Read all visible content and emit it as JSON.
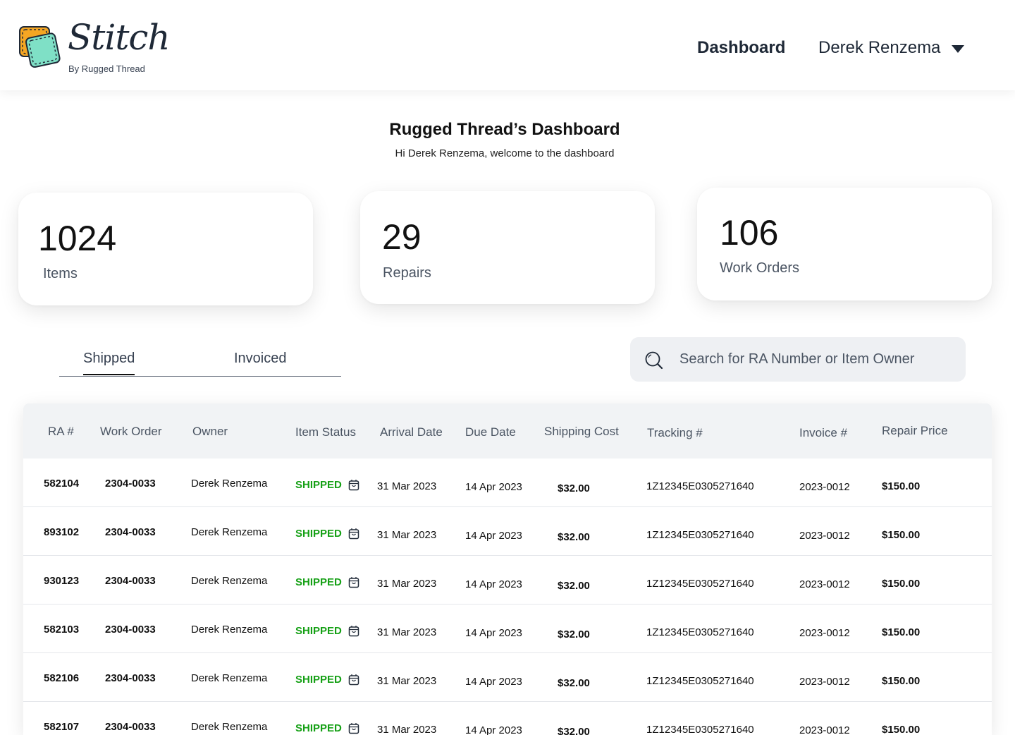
{
  "header": {
    "logo_word": "Stitch",
    "logo_sub": "By Rugged Thread",
    "nav_dashboard": "Dashboard",
    "user_name": "Derek Renzema"
  },
  "page": {
    "title": "Rugged Thread’s Dashboard",
    "subtitle": "Hi Derek Renzema, welcome to the dashboard"
  },
  "stats": [
    {
      "value": "1024",
      "label": "Items"
    },
    {
      "value": "29",
      "label": "Repairs"
    },
    {
      "value": "106",
      "label": "Work Orders"
    }
  ],
  "tabs": [
    {
      "label": "Shipped",
      "active": true
    },
    {
      "label": "Invoiced",
      "active": false
    }
  ],
  "search": {
    "placeholder": "Search for RA Number or Item Owner",
    "icon": "search-icon"
  },
  "table": {
    "columns": [
      "RA #",
      "Work Order",
      "Owner",
      "Item Status",
      "Arrival Date",
      "Due Date",
      "Shipping Cost",
      "Tracking #",
      "Invoice #",
      "Repair Price"
    ],
    "rows": [
      {
        "ra": "582104",
        "work_order": "2304-0033",
        "owner": "Derek Renzema",
        "status": "SHIPPED",
        "arrival": "31 Mar 2023",
        "due": "14 Apr 2023",
        "shipping": "$32.00",
        "tracking": "1Z12345E0305271640",
        "invoice": "2023-0012",
        "price": "$150.00"
      },
      {
        "ra": "893102",
        "work_order": "2304-0033",
        "owner": "Derek Renzema",
        "status": "SHIPPED",
        "arrival": "31 Mar 2023",
        "due": "14 Apr 2023",
        "shipping": "$32.00",
        "tracking": "1Z12345E0305271640",
        "invoice": "2023-0012",
        "price": "$150.00"
      },
      {
        "ra": "930123",
        "work_order": "2304-0033",
        "owner": "Derek Renzema",
        "status": "SHIPPED",
        "arrival": "31 Mar 2023",
        "due": "14 Apr 2023",
        "shipping": "$32.00",
        "tracking": "1Z12345E0305271640",
        "invoice": "2023-0012",
        "price": "$150.00"
      },
      {
        "ra": "582103",
        "work_order": "2304-0033",
        "owner": "Derek Renzema",
        "status": "SHIPPED",
        "arrival": "31 Mar 2023",
        "due": "14 Apr 2023",
        "shipping": "$32.00",
        "tracking": "1Z12345E0305271640",
        "invoice": "2023-0012",
        "price": "$150.00"
      },
      {
        "ra": "582106",
        "work_order": "2304-0033",
        "owner": "Derek Renzema",
        "status": "SHIPPED",
        "arrival": "31 Mar 2023",
        "due": "14 Apr 2023",
        "shipping": "$32.00",
        "tracking": "1Z12345E0305271640",
        "invoice": "2023-0012",
        "price": "$150.00"
      },
      {
        "ra": "582107",
        "work_order": "2304-0033",
        "owner": "Derek Renzema",
        "status": "SHIPPED",
        "arrival": "31 Mar 2023",
        "due": "14 Apr 2023",
        "shipping": "$32.00",
        "tracking": "1Z12345E0305271640",
        "invoice": "2023-0012",
        "price": "$150.00"
      }
    ]
  },
  "colors": {
    "status_shipped": "#15a015",
    "logo_orange": "#f5a623",
    "logo_mint": "#7fe0c6",
    "header_bg": "#f1f3f5",
    "search_bg": "#eef0f3"
  }
}
